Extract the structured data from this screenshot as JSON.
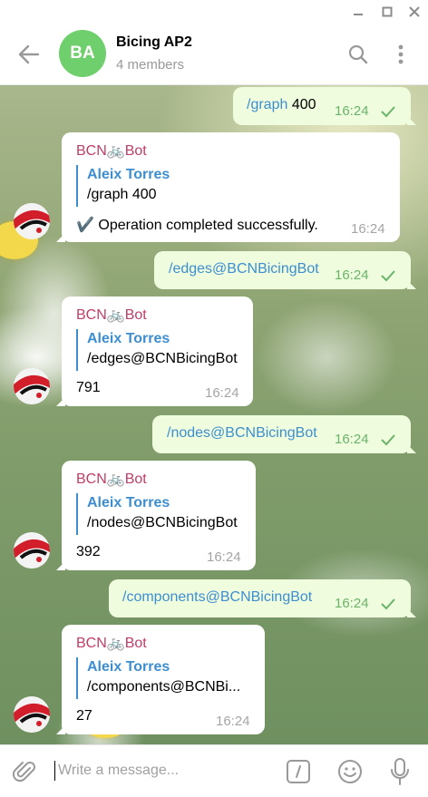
{
  "window": {
    "icons": {
      "minimize": "minimize-icon",
      "maximize": "maximize-icon",
      "close": "close-icon"
    }
  },
  "header": {
    "avatar_initials": "BA",
    "title": "Bicing AP2",
    "subtitle": "4 members",
    "icons": {
      "back": "back-arrow-icon",
      "search": "search-icon",
      "more": "more-vertical-icon"
    }
  },
  "colors": {
    "accent": "#3d8ed0",
    "sender": "#c03d67",
    "outgoing_bg": "#effdde",
    "avatar_bg": "#6fcf6c",
    "check": "#6ab36a"
  },
  "messages": [
    {
      "dir": "out",
      "command": "/graph",
      "arg": " 400",
      "time": "16:24",
      "status": "sent"
    },
    {
      "dir": "in",
      "sender": "BCN🚲Bot",
      "quote_name": "Aleix Torres",
      "quote_text": "/graph 400",
      "text": "✔️ Operation completed successfully.",
      "time": "16:24"
    },
    {
      "dir": "out",
      "command": "/edges@BCNBicingBot",
      "arg": "",
      "time": "16:24",
      "status": "sent"
    },
    {
      "dir": "in",
      "sender": "BCN🚲Bot",
      "quote_name": "Aleix Torres",
      "quote_text": "/edges@BCNBicingBot",
      "text": "791",
      "time": "16:24"
    },
    {
      "dir": "out",
      "command": "/nodes@BCNBicingBot",
      "arg": "",
      "time": "16:24",
      "status": "sent"
    },
    {
      "dir": "in",
      "sender": "BCN🚲Bot",
      "quote_name": "Aleix Torres",
      "quote_text": "/nodes@BCNBicingBot",
      "text": "392",
      "time": "16:24"
    },
    {
      "dir": "out",
      "command": "/components@BCNBicingBot",
      "arg": "",
      "time": "16:24",
      "status": "sent"
    },
    {
      "dir": "in",
      "sender": "BCN🚲Bot",
      "quote_name": "Aleix Torres",
      "quote_text": "/components@BCNBi...",
      "text": "27",
      "time": "16:24"
    }
  ],
  "composer": {
    "placeholder": "Write a message...",
    "icons": {
      "attach": "paperclip-icon",
      "commands": "bot-commands-icon",
      "emoji": "emoji-icon",
      "voice": "microphone-icon"
    }
  }
}
